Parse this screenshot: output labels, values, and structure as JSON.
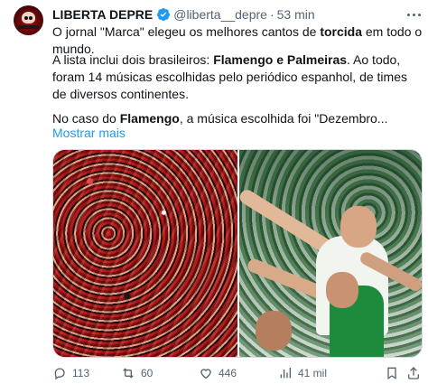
{
  "author": {
    "display_name": "LIBERTA DEPRE",
    "handle": "@liberta__depre",
    "separator": "·",
    "time": "53 min"
  },
  "body": {
    "p1": {
      "a": "O jornal \"Marca\" elegeu os melhores cantos de ",
      "b": "torcida",
      "c": " em todo o mundo."
    },
    "p2": {
      "a": "A lista inclui dois brasileiros: ",
      "b": "Flamengo e Palmeiras",
      "c": ". Ao todo, foram 14 músicas escolhidas pelo periódico espanhol, de times de diversos continentes."
    },
    "p3": {
      "a": "No caso do ",
      "b": "Flamengo",
      "c": ", a música escolhida foi \"Dezembro..."
    },
    "show_more": "Mostrar mais"
  },
  "actions": {
    "replies": "113",
    "retweets": "60",
    "likes": "446",
    "views": "41 mil"
  },
  "colors": {
    "accent": "#1d9bf0",
    "text": "#0f1419",
    "muted": "#536471",
    "flamengo_red": "#b81d1d",
    "palmeiras_green": "#1e8a3c"
  },
  "icons": [
    "verified-icon",
    "more-options-icon",
    "reply-icon",
    "retweet-icon",
    "like-icon",
    "views-icon",
    "bookmark-icon",
    "share-icon"
  ]
}
